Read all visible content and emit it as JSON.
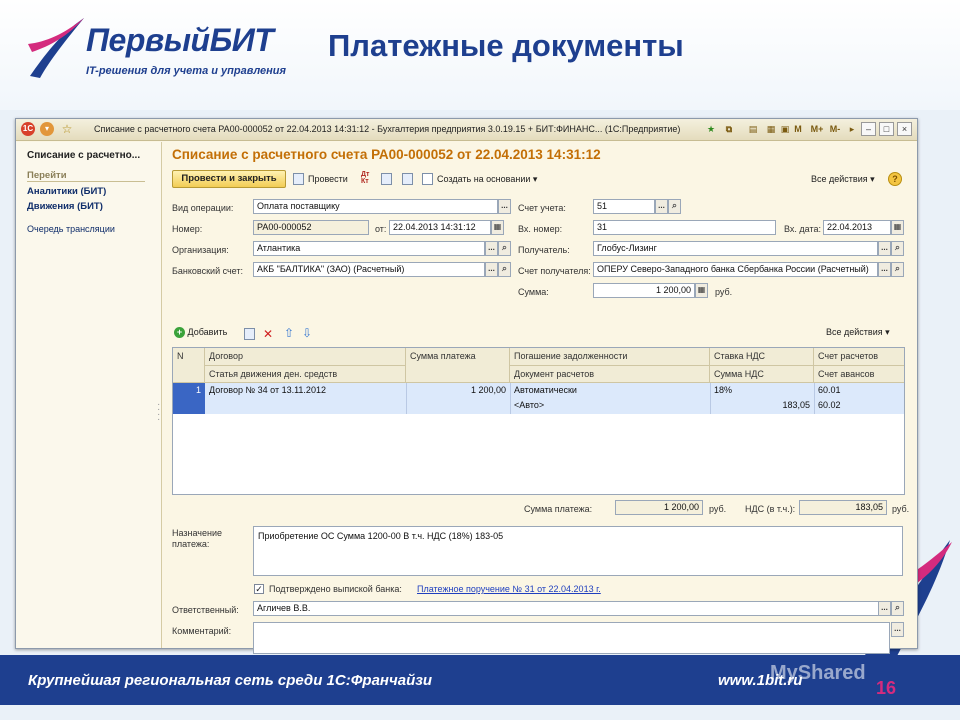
{
  "slide": {
    "logo_name": "ПервыйБИТ",
    "logo_tagline": "IT-решения для учета и управления",
    "title": "Платежные документы",
    "footer_left": "Крупнейшая региональная сеть среди 1С:Франчайзи",
    "footer_right": "www.1bit.ru",
    "page_number": "16",
    "watermark": "MyShared"
  },
  "window": {
    "title": "Списание с расчетного счета РА00-000052 от 22.04.2013 14:31:12 - Бухгалтерия предприятия 3.0.19.15 + БИТ:ФИНАНС... (1С:Предприятие)",
    "tools": [
      "M",
      "M+",
      "M-"
    ]
  },
  "nav": {
    "header": "Списание с расчетно...",
    "goto": "Перейти",
    "items": [
      "Аналитики (БИТ)",
      "Движения (БИТ)"
    ],
    "queue": "Очередь трансляции"
  },
  "form": {
    "title": "Списание с расчетного счета РА00-000052 от 22.04.2013 14:31:12",
    "post_close": "Провести и закрыть",
    "post": "Провести",
    "create_based": "Создать на основании",
    "all_actions": "Все действия",
    "operation_label": "Вид операции:",
    "operation_value": "Оплата поставщику",
    "number_label": "Номер:",
    "number_value": "РА00-000052",
    "from_label": "от:",
    "from_value": "22.04.2013 14:31:12",
    "org_label": "Организация:",
    "org_value": "Атлантика",
    "bank_label": "Банковский счет:",
    "bank_value": "АКБ \"БАЛТИКА\" (ЗАО) (Расчетный)",
    "account_label": "Счет учета:",
    "account_value": "51",
    "in_number_label": "Вх. номер:",
    "in_number_value": "31",
    "in_date_label": "Вх. дата:",
    "in_date_value": "22.04.2013",
    "recipient_label": "Получатель:",
    "recipient_value": "Глобус-Лизинг",
    "recipient_account_label": "Счет получателя:",
    "recipient_account_value": "ОПЕРУ Северо-Западного банка Сбербанка России (Расчетный)",
    "sum_label": "Сумма:",
    "sum_value": "1 200,00",
    "rub": "руб."
  },
  "table": {
    "add": "Добавить",
    "all_actions": "Все действия",
    "headers_top": [
      "N",
      "Договор",
      "Сумма платежа",
      "Погашение задолженности",
      "Ставка НДС",
      "Счет расчетов"
    ],
    "headers_bottom": [
      "Статья движения ден. средств",
      "Документ расчетов",
      "Сумма НДС",
      "Счет авансов"
    ],
    "row": {
      "n": "1",
      "contract": "Договор № 34 от 13.11.2012",
      "sum": "1 200,00",
      "repayment": "Автоматически",
      "doc": "<Авто>",
      "vat_rate": "18%",
      "vat_sum": "183,05",
      "acc_settle": "60.01",
      "acc_adv": "60.02"
    }
  },
  "totals": {
    "sum_label": "Сумма платежа:",
    "sum_value": "1 200,00",
    "vat_label": "НДС (в т.ч.):",
    "vat_value": "183,05",
    "rub": "руб."
  },
  "purpose": {
    "label": "Назначение платежа:",
    "value": "Приобретение ОС Сумма 1200-00 В т.ч. НДС  (18%) 183-05"
  },
  "confirm": {
    "label": "Подтверждено выпиской банка:",
    "link": "Платежное поручение № 31 от 22.04.2013 г."
  },
  "responsible": {
    "label": "Ответственный:",
    "value": "Агличев В.В."
  },
  "comment": {
    "label": "Комментарий:",
    "value": ""
  },
  "colors": {
    "brand": "#1e3f8f",
    "doc_title": "#c36f06",
    "accent_pink": "#d42b7e",
    "selection": "#3a66c4"
  }
}
